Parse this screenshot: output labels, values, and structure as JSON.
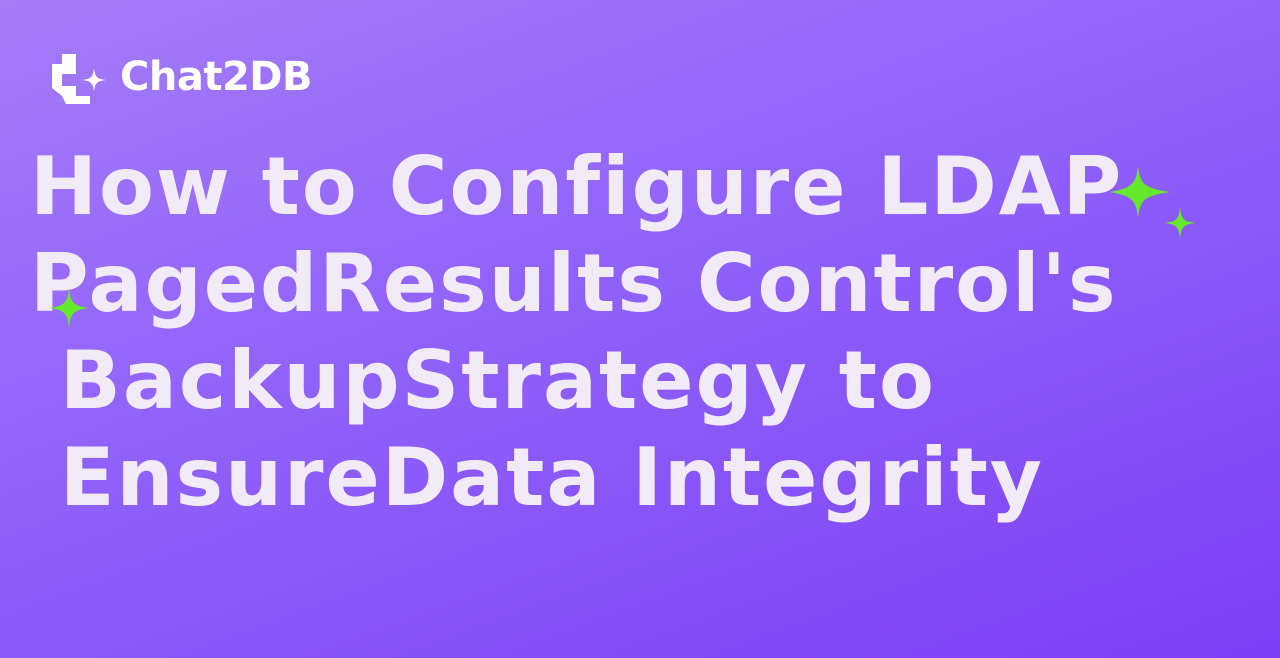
{
  "brand": {
    "name": "Chat2DB"
  },
  "title": {
    "lines": [
      "How to Configure LDAP",
      "PagedResults Control's",
      " BackupStrategy to",
      " EnsureData Integrity"
    ]
  },
  "colors": {
    "background_start": "#a47cf8",
    "background_end": "#7c3ff4",
    "title_text": "#f1ebf8",
    "sparkle": "#66e82c",
    "logo": "#ffffff"
  },
  "icons": {
    "logo": "chat2db-logo-icon",
    "sparkle": "sparkle-icon"
  }
}
